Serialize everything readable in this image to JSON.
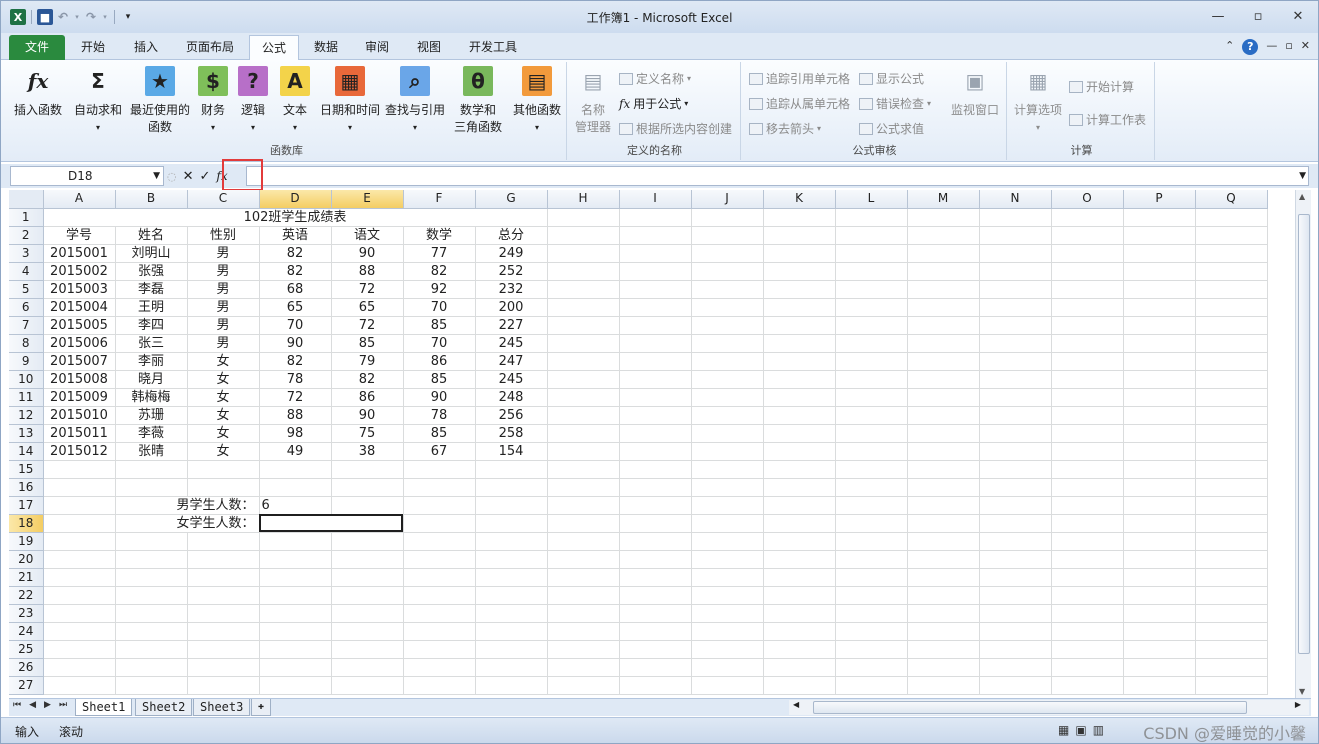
{
  "window": {
    "title": "工作簿1 - Microsoft Excel"
  },
  "tabs": [
    "文件",
    "开始",
    "插入",
    "页面布局",
    "公式",
    "数据",
    "审阅",
    "视图",
    "开发工具"
  ],
  "active_tab": "公式",
  "ribbon": {
    "function_library": {
      "label": "函数库",
      "buttons": [
        "插入函数",
        "自动求和",
        "最近使用的",
        "函数",
        "财务",
        "逻辑",
        "文本",
        "日期和时间",
        "查找与引用",
        "数学和",
        "三角函数",
        "其他函数"
      ]
    },
    "defined_names": {
      "label": "定义的名称",
      "name_manager": [
        "名称",
        "管理器"
      ],
      "define_name": "定义名称",
      "use_in_formula": "用于公式",
      "create_from_selection": "根据所选内容创建"
    },
    "formula_auditing": {
      "label": "公式审核",
      "trace_precedents": "追踪引用单元格",
      "trace_dependents": "追踪从属单元格",
      "remove_arrows": "移去箭头",
      "show_formulas": "显示公式",
      "error_checking": "错误检查",
      "evaluate_formula": "公式求值",
      "watch_window": "监视窗口"
    },
    "calculation": {
      "label": "计算",
      "calc_options": "计算选项",
      "calc_now": "开始计算",
      "calc_sheet": "计算工作表"
    }
  },
  "formula_bar": {
    "name_box": "D18",
    "content": ""
  },
  "sheet": {
    "columns": [
      "A",
      "B",
      "C",
      "D",
      "E",
      "F",
      "G",
      "H",
      "I",
      "J",
      "K",
      "L",
      "M",
      "N",
      "O",
      "P",
      "Q"
    ],
    "title": "102班学生成绩表",
    "header": [
      "学号",
      "姓名",
      "性别",
      "英语",
      "语文",
      "数学",
      "总分"
    ],
    "rows": [
      [
        "2015001",
        "刘明山",
        "男",
        "82",
        "90",
        "77",
        "249"
      ],
      [
        "2015002",
        "张强",
        "男",
        "82",
        "88",
        "82",
        "252"
      ],
      [
        "2015003",
        "李磊",
        "男",
        "68",
        "72",
        "92",
        "232"
      ],
      [
        "2015004",
        "王明",
        "男",
        "65",
        "65",
        "70",
        "200"
      ],
      [
        "2015005",
        "李四",
        "男",
        "70",
        "72",
        "85",
        "227"
      ],
      [
        "2015006",
        "张三",
        "男",
        "90",
        "85",
        "70",
        "245"
      ],
      [
        "2015007",
        "李丽",
        "女",
        "82",
        "79",
        "86",
        "247"
      ],
      [
        "2015008",
        "晓月",
        "女",
        "78",
        "82",
        "85",
        "245"
      ],
      [
        "2015009",
        "韩梅梅",
        "女",
        "72",
        "86",
        "90",
        "248"
      ],
      [
        "2015010",
        "苏珊",
        "女",
        "88",
        "90",
        "78",
        "256"
      ],
      [
        "2015011",
        "李薇",
        "女",
        "98",
        "75",
        "85",
        "258"
      ],
      [
        "2015012",
        "张晴",
        "女",
        "49",
        "38",
        "67",
        "154"
      ]
    ],
    "male_label": "男学生人数：",
    "male_value": "6",
    "female_label": "女学生人数：",
    "female_value": "",
    "row_numbers": [
      "1",
      "2",
      "3",
      "4",
      "5",
      "6",
      "7",
      "8",
      "9",
      "10",
      "11",
      "12",
      "13",
      "14",
      "15",
      "16",
      "17",
      "18",
      "19",
      "20",
      "21",
      "22",
      "23",
      "24",
      "25",
      "26",
      "27"
    ]
  },
  "sheet_tabs": [
    "Sheet1",
    "Sheet2",
    "Sheet3"
  ],
  "status": {
    "mode": "输入",
    "scroll": "滚动"
  },
  "watermark": "CSDN @爱睡觉的小馨"
}
